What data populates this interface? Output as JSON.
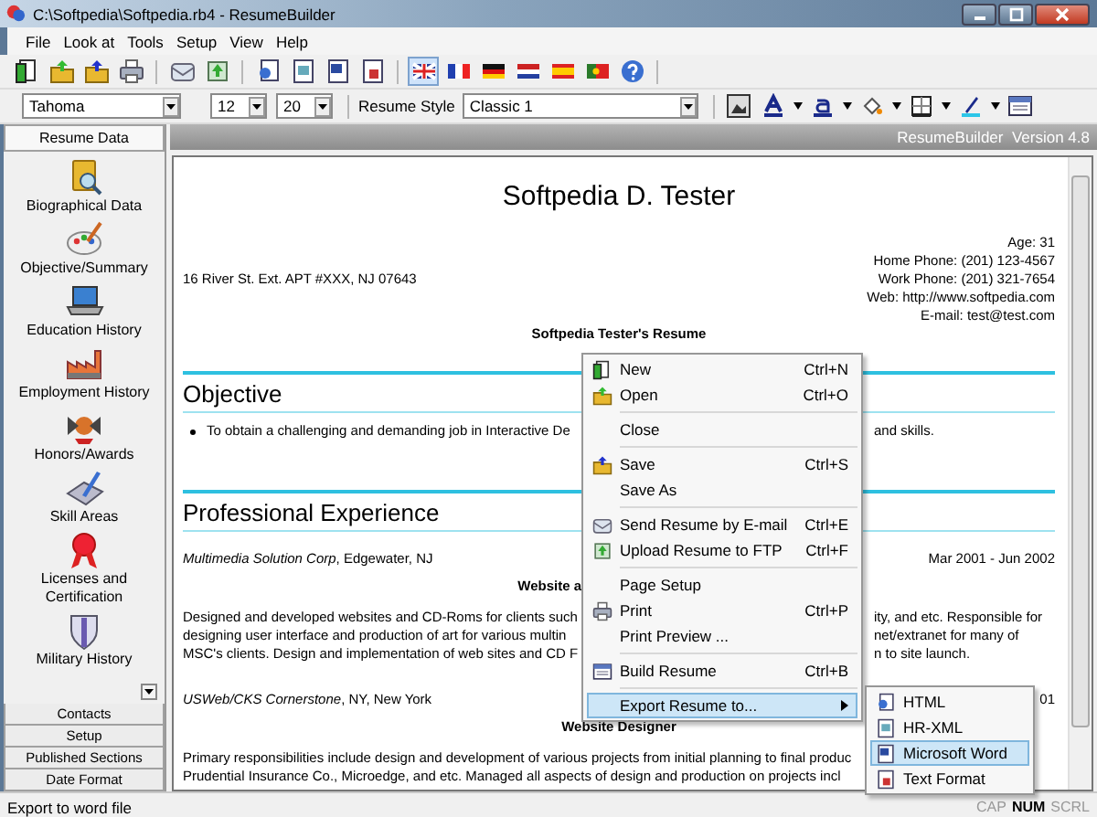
{
  "window": {
    "title": "C:\\Softpedia\\Softpedia.rb4 - ResumeBuilder"
  },
  "menu_bar": [
    "File",
    "Look at",
    "Tools",
    "Setup",
    "View",
    "Help"
  ],
  "toolbar": {
    "buttons": [
      {
        "pressed": false
      },
      {
        "pressed": false
      },
      {
        "pressed": false
      },
      {
        "pressed": false
      },
      {
        "pressed": false
      },
      {
        "pressed": false
      },
      {
        "pressed": false
      },
      {
        "pressed": false
      },
      {
        "pressed": false
      },
      {
        "pressed": false
      },
      {
        "pressed": true
      },
      {
        "pressed": false
      },
      {
        "pressed": false
      },
      {
        "pressed": false
      },
      {
        "pressed": false
      },
      {
        "pressed": false
      },
      {
        "pressed": false
      }
    ]
  },
  "format_bar": {
    "font_field": "Tahoma",
    "size_field": "12",
    "second_size_field": "20",
    "style_label": "Resume Style",
    "style_field": "Classic 1"
  },
  "sidebar": {
    "tabs": [
      {
        "label": "Resume Data",
        "selected": true
      }
    ],
    "items": [
      {
        "label": "Biographical Data"
      },
      {
        "label": "Objective/Summary"
      },
      {
        "label": "Education History"
      },
      {
        "label": "Employment History"
      },
      {
        "label": "Honors/Awards"
      },
      {
        "label": "Skill Areas"
      },
      {
        "label": "Licenses and Certification"
      },
      {
        "label": "Military History"
      }
    ],
    "bottom_tabs": [
      {
        "label": "Contacts",
        "selected": false
      },
      {
        "label": "Setup",
        "selected": false
      },
      {
        "label": "Published Sections",
        "selected": false
      },
      {
        "label": "Date Format",
        "selected": false
      }
    ]
  },
  "header_bar": {
    "text": "ResumeBuilder  Version 4.8"
  },
  "document": {
    "rows": [
      {
        "kind": "name",
        "text": "Softpedia D. Tester"
      },
      {
        "kind": "contacts",
        "address": "16 River St. Ext. APT #XXX, NJ 07643",
        "lines": [
          "Age: 31",
          "Home Phone: (201) 123-4567",
          "Work Phone: (201) 321-7654",
          "Web: http://www.softpedia.com",
          "E-mail: test@test.com"
        ]
      },
      {
        "kind": "resume_title",
        "text": "Softpedia Tester's Resume"
      },
      {
        "kind": "heading",
        "text": "Objective"
      },
      {
        "kind": "bullet",
        "left": "To obtain a challenging and demanding job in Interactive De",
        "right": "and skills."
      },
      {
        "kind": "heading",
        "text": "Professional Experience"
      },
      {
        "kind": "company",
        "text": "*Multimedia Solution Corp*, Edgewater, NJ",
        "dates": "Mar 2001 - Jun 2002"
      },
      {
        "kind": "job_title",
        "left": "Website a"
      },
      {
        "kind": "paragraph",
        "lines": [
          {
            "left": "Designed and developed websites and CD-Roms for clients such",
            "right": "ity, and etc. Responsible for"
          },
          {
            "left": "designing user interface and production of art for various multin",
            "right": "net/extranet for many of"
          },
          {
            "left": "MSC's clients. Design and implementation of web sites and CD F",
            "right": "n to site launch."
          }
        ]
      },
      {
        "kind": "company",
        "text": "*USWeb/CKS Cornerstone*, NY, New York",
        "dates": "01"
      },
      {
        "kind": "job_title",
        "text": "Website Designer"
      },
      {
        "kind": "paragraph",
        "lines": [
          {
            "left": "Primary responsibilities include design and development of various projects from initial planning to final produc"
          },
          {
            "left": "Prudential Insurance Co., Microedge, and etc. Managed all aspects of design and production on projects incl"
          }
        ]
      }
    ]
  },
  "context_menu": {
    "items": [
      {
        "kind": "item",
        "label": "New",
        "shortcut": "Ctrl+N",
        "selected": false
      },
      {
        "kind": "item",
        "label": "Open",
        "shortcut": "Ctrl+O",
        "selected": false
      },
      {
        "kind": "separator"
      },
      {
        "kind": "item",
        "label": "Close",
        "selected": false
      },
      {
        "kind": "separator"
      },
      {
        "kind": "item",
        "label": "Save",
        "shortcut": "Ctrl+S",
        "selected": false
      },
      {
        "kind": "item",
        "label": "Save As",
        "selected": false
      },
      {
        "kind": "separator"
      },
      {
        "kind": "item",
        "label": "Send Resume by E-mail",
        "shortcut": "Ctrl+E",
        "selected": false
      },
      {
        "kind": "item",
        "label": "Upload Resume to FTP",
        "shortcut": "Ctrl+F",
        "selected": false
      },
      {
        "kind": "separator"
      },
      {
        "kind": "item",
        "label": "Page Setup",
        "selected": false
      },
      {
        "kind": "item",
        "label": "Print",
        "shortcut": "Ctrl+P",
        "selected": false
      },
      {
        "kind": "item",
        "label": "Print Preview ...",
        "selected": false
      },
      {
        "kind": "separator"
      },
      {
        "kind": "item",
        "label": "Build Resume",
        "shortcut": "Ctrl+B",
        "selected": false
      },
      {
        "kind": "separator"
      },
      {
        "kind": "submenu",
        "label": "Export Resume to...",
        "selected": true
      }
    ]
  },
  "submenu": {
    "items": [
      {
        "label": "HTML",
        "selected": false
      },
      {
        "label": "HR-XML",
        "selected": false
      },
      {
        "label": "Microsoft Word",
        "selected": true
      },
      {
        "label": "Text Format",
        "selected": false
      }
    ]
  },
  "status_bar": {
    "text": "Export to word file",
    "indicators": [
      {
        "label": "CAP",
        "on": false
      },
      {
        "label": "NUM",
        "on": true
      },
      {
        "label": "SCRL",
        "on": false
      }
    ]
  }
}
